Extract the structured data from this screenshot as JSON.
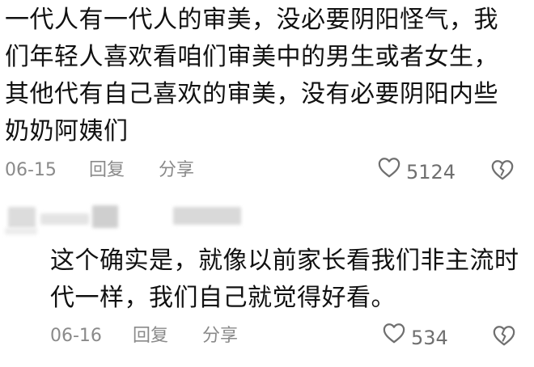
{
  "comments": [
    {
      "text": "一代人有一代人的审美，没必要阴阳怪气，我们年轻人喜欢看咱们审美中的男生或者女生，其他代有自己喜欢的审美，没有必要阴阳内些奶奶阿姨们",
      "date": "06-15",
      "reply_label": "回复",
      "share_label": "分享",
      "likes": "5124"
    },
    {
      "text": "这个确实是，就像以前家长看我们非主流时代一样，我们自己就觉得好看。",
      "date": "06-16",
      "reply_label": "回复",
      "share_label": "分享",
      "likes": "534"
    }
  ],
  "icons": {
    "like": "heart-outline-icon",
    "dislike": "broken-heart-icon"
  },
  "colors": {
    "text": "#111111",
    "meta": "#8a8a8a",
    "icon": "#6f6f6f"
  }
}
